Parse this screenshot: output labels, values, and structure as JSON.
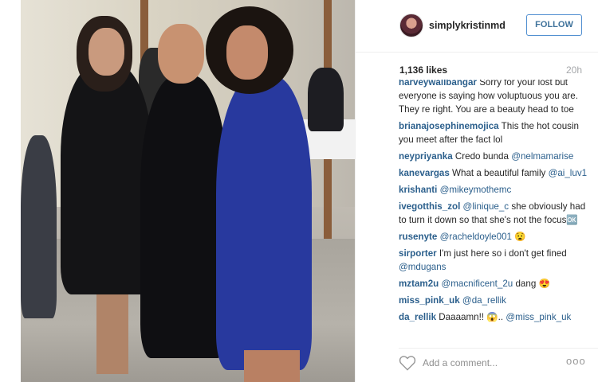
{
  "post": {
    "username": "simplykristinmd",
    "follow_label": "FOLLOW",
    "likes": "1,136 likes",
    "time_ago": "20h"
  },
  "comments": [
    {
      "author": "harveywallbangar",
      "text": "Sorry for your lost but everyone is saying how voluptuous you are. They re right. You are a beauty head to toe"
    },
    {
      "author": "brianajosephinemojica",
      "text": "This the hot cousin you meet after the fact lol"
    },
    {
      "author": "neypriyanka",
      "text": "Credo bunda",
      "mention": "@nelmamarise"
    },
    {
      "author": "kanevargas",
      "text": "What a beautiful family",
      "mention": "@ai_luv1"
    },
    {
      "author": "krishanti",
      "text": "",
      "mention": "@mikeymothemc"
    },
    {
      "author": "ivegotthis_zol",
      "mention": "@linique_c",
      "text": "she obviously had to turn it down so that she's not the focus🆗"
    },
    {
      "author": "rusenyte",
      "mention": "@racheldoyle001",
      "text": "😧"
    },
    {
      "author": "sirporter",
      "text": "I'm just here so i don't get fined",
      "mention": "@mdugans"
    },
    {
      "author": "mztam2u",
      "mention": "@macnificent_2u",
      "text": "dang 😍"
    },
    {
      "author": "miss_pink_uk",
      "text": "",
      "mention": "@da_rellik"
    },
    {
      "author": "da_rellik",
      "text": "Daaaamn!! 😱..",
      "mention": "@miss_pink_uk"
    }
  ],
  "footer": {
    "comment_placeholder": "Add a comment...",
    "more_glyph": "ooo"
  },
  "icons": {
    "heart": "heart-icon",
    "more": "more-options-icon"
  },
  "colors": {
    "follow_blue": "#3f729b",
    "link_blue": "#2b5f8c"
  }
}
